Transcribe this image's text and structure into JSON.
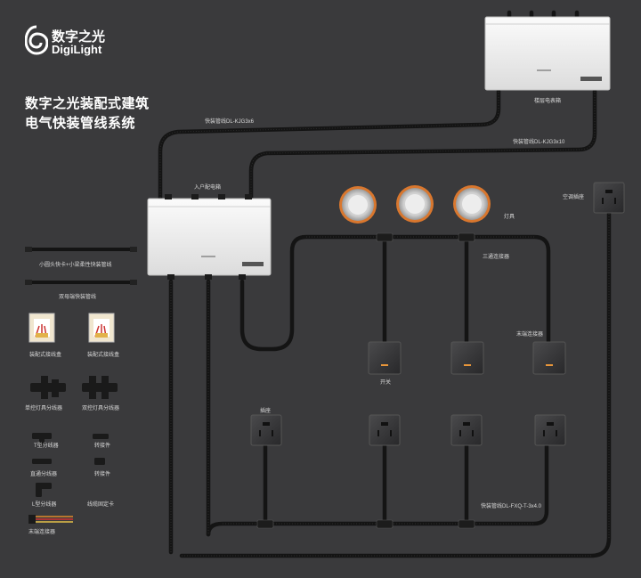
{
  "brand": {
    "name_cn": "数字之光",
    "name_en": "DigiLight"
  },
  "title": {
    "line1": "数字之光装配式建筑",
    "line2": "电气快装管线系统"
  },
  "labels": {
    "floor_meter_box": "楼层电表箱",
    "conduit_top": "快装管线DL-KJG3x6",
    "conduit_right": "快装管线DL-KJG3x10",
    "home_distribution_box": "入户配电箱",
    "lamps": "灯具",
    "ac_socket": "空调插座",
    "tee_connector": "三通连接器",
    "end_connector_right": "末端连接器",
    "switch": "开关",
    "socket": "插座",
    "bottom_conduit": "快装管线DL-FXQ-T-3x4.0"
  },
  "legend": {
    "conduit_small_head": "小圆头快卡+小梁柔性快装管线",
    "conduit_double_female": "双母端快装管线",
    "junction_box_1": "装配式接线盒",
    "junction_box_2": "装配式接线盒",
    "single_lamp_splitter": "单控灯具分线器",
    "double_lamp_splitter": "双控灯具分线器",
    "t_splitter": "T型分线器",
    "adapter_1": "转接件",
    "straight_splitter": "直通分线器",
    "adapter_2": "转接件",
    "l_splitter": "L型分线器",
    "fixing_clip": "线缆固定卡",
    "end_connector": "末端连接器"
  },
  "colors": {
    "background": "#3a3a3c",
    "box": "#f2f2f2",
    "conduit": "#141414",
    "panel": "#2f2f31",
    "switch_led": "#e8963a",
    "lamp_ring": "#d9772e"
  },
  "icons": {
    "brand_logo": "spiral-logo-icon",
    "lamp": "downlight-icon",
    "switch": "switch-panel-icon",
    "socket": "socket-panel-icon"
  }
}
